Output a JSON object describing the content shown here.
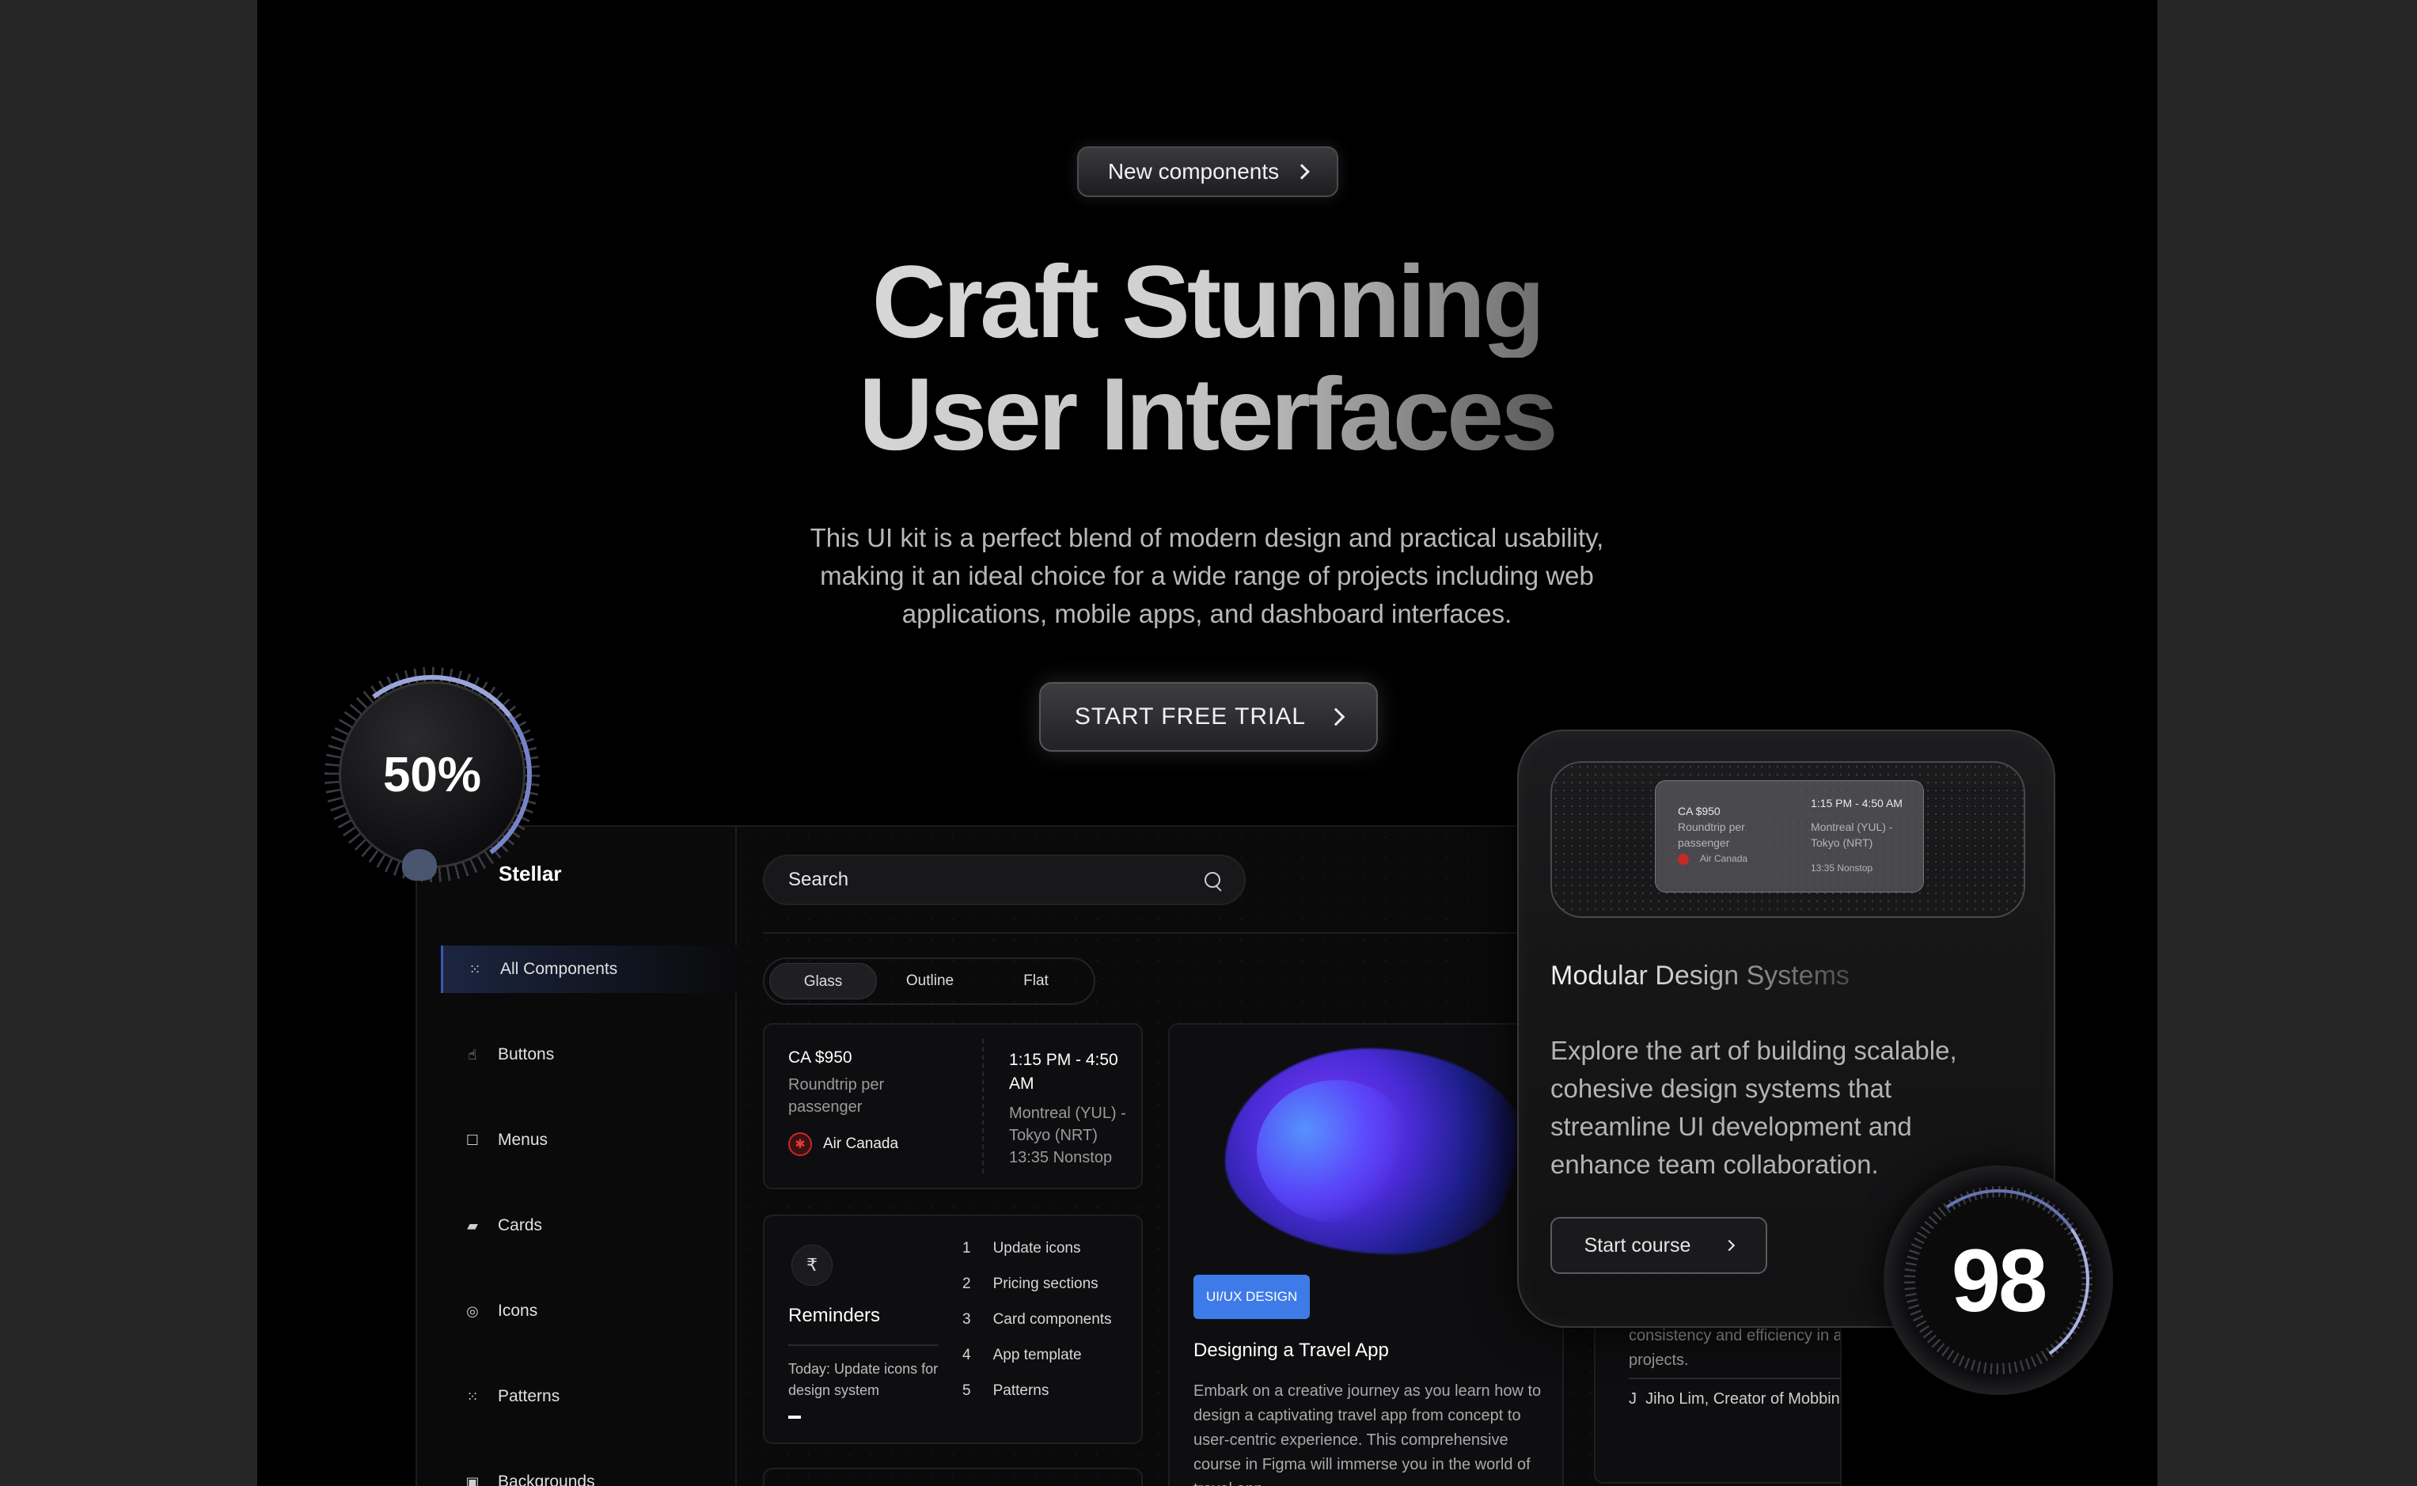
{
  "hero": {
    "badge_label": "New components",
    "headline_line1": "Craft Stunning",
    "headline_line2": "User Interfaces",
    "subtext": "This UI kit is a perfect blend of modern design and practical usability, making it an ideal choice for a wide range of projects including web applications, mobile apps, and dashboard interfaces.",
    "cta_label": "START FREE TRIAL"
  },
  "gauges": {
    "progress": {
      "value": 50,
      "label": "50%"
    },
    "score": {
      "value": 98,
      "label": "98"
    }
  },
  "sidebar": {
    "brand": "Stellar",
    "items": [
      {
        "label": "All Components",
        "icon": "grid-dots-icon",
        "active": true
      },
      {
        "label": "Buttons",
        "icon": "pointer-icon",
        "active": false
      },
      {
        "label": "Menus",
        "icon": "square-icon",
        "active": false
      },
      {
        "label": "Cards",
        "icon": "cards-icon",
        "active": false
      },
      {
        "label": "Icons",
        "icon": "circle-target-icon",
        "active": false
      },
      {
        "label": "Patterns",
        "icon": "dot-grid-icon",
        "active": false
      },
      {
        "label": "Backgrounds",
        "icon": "image-icon",
        "active": false
      }
    ]
  },
  "search": {
    "placeholder": "Search"
  },
  "segments": [
    "Glass",
    "Outline",
    "Flat"
  ],
  "flight_card": {
    "price": "CA $950",
    "fare_type": "Roundtrip per passenger",
    "airline": "Air Canada",
    "time": "1:15 PM - 4:50 AM",
    "route": "Montreal (YUL) - Tokyo (NRT)",
    "duration": "13:35 Nonstop"
  },
  "reminders_card": {
    "title": "Reminders",
    "today": "Today: Update icons for design system",
    "items": [
      {
        "num": "1",
        "label": "Update icons"
      },
      {
        "num": "2",
        "label": "Pricing sections"
      },
      {
        "num": "3",
        "label": "Card components"
      },
      {
        "num": "4",
        "label": "App template"
      },
      {
        "num": "5",
        "label": "Patterns"
      }
    ]
  },
  "course_card": {
    "tag": "UI/UX DESIGN",
    "title": "Designing a Travel App",
    "description": "Embark on a creative journey as you learn how to design a captivating travel app from concept to user-centric experience. This comprehensive course in Figma will immerse you in the world of travel app"
  },
  "testimonial_card": {
    "description": "consistency and efficiency in all your projects.",
    "author_initial": "J",
    "author": "Jiho Lim, Creator of Mobbin"
  },
  "modular_card": {
    "title": "Modular Design Systems",
    "description": "Explore the art of building scalable, cohesive design systems that streamline UI development and enhance team collaboration.",
    "button_label": "Start course",
    "preview": {
      "price": "CA $950",
      "fare_type": "Roundtrip per passenger",
      "airline": "Air Canada",
      "time": "1:15 PM - 4:50 AM",
      "route": "Montreal (YUL) - Tokyo (NRT)",
      "duration": "13:35 Nonstop"
    }
  },
  "colors": {
    "accent_blue": "#3f7be8",
    "gauge_blue": "#9aa6d8",
    "airline_red": "#c62828"
  }
}
